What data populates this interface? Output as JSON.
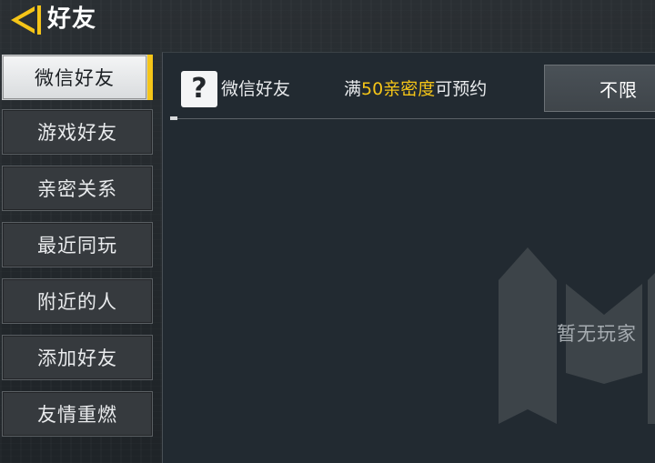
{
  "header": {
    "title": "好友"
  },
  "sidebar": {
    "tabs": [
      {
        "label": "微信好友",
        "active": true
      },
      {
        "label": "游戏好友",
        "active": false
      },
      {
        "label": "亲密关系",
        "active": false
      },
      {
        "label": "最近同玩",
        "active": false
      },
      {
        "label": "附近的人",
        "active": false
      },
      {
        "label": "添加好友",
        "active": false
      },
      {
        "label": "友情重燃",
        "active": false
      }
    ]
  },
  "main": {
    "category_icon": "?",
    "category_label": "微信好友",
    "requirement": {
      "prefix": "满",
      "highlight": "50亲密度",
      "suffix": "可预约"
    },
    "filter_button": "不限",
    "empty_state": "暂无玩家"
  },
  "colors": {
    "accent": "#f5c518",
    "active_tab": "#eceeef",
    "panel": "#222a31"
  }
}
